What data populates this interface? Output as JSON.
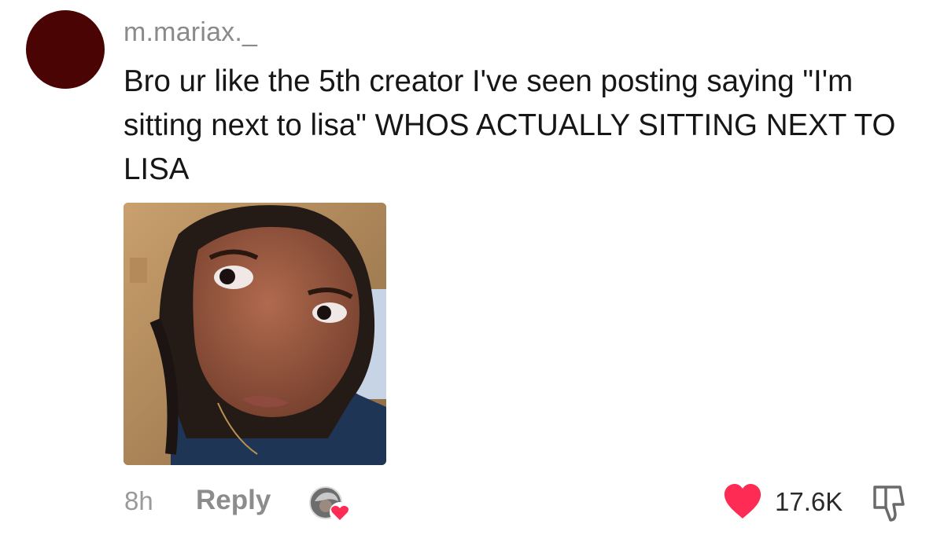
{
  "comment": {
    "username": "m.mariax._",
    "text": "Bro ur like the 5th creator I've seen posting saying \"I'm sitting next to lisa\" WHOS ACTUALLY SITTING NEXT TO LISA",
    "time": "8h",
    "reply_label": "Reply",
    "like_count": "17.6K",
    "avatar_color": "#4a0404",
    "like_color": "#fe2c55"
  },
  "icons": {
    "creator_liked": "creator-avatar-with-heart-icon",
    "like": "heart-icon",
    "dislike": "thumbs-down-icon"
  }
}
